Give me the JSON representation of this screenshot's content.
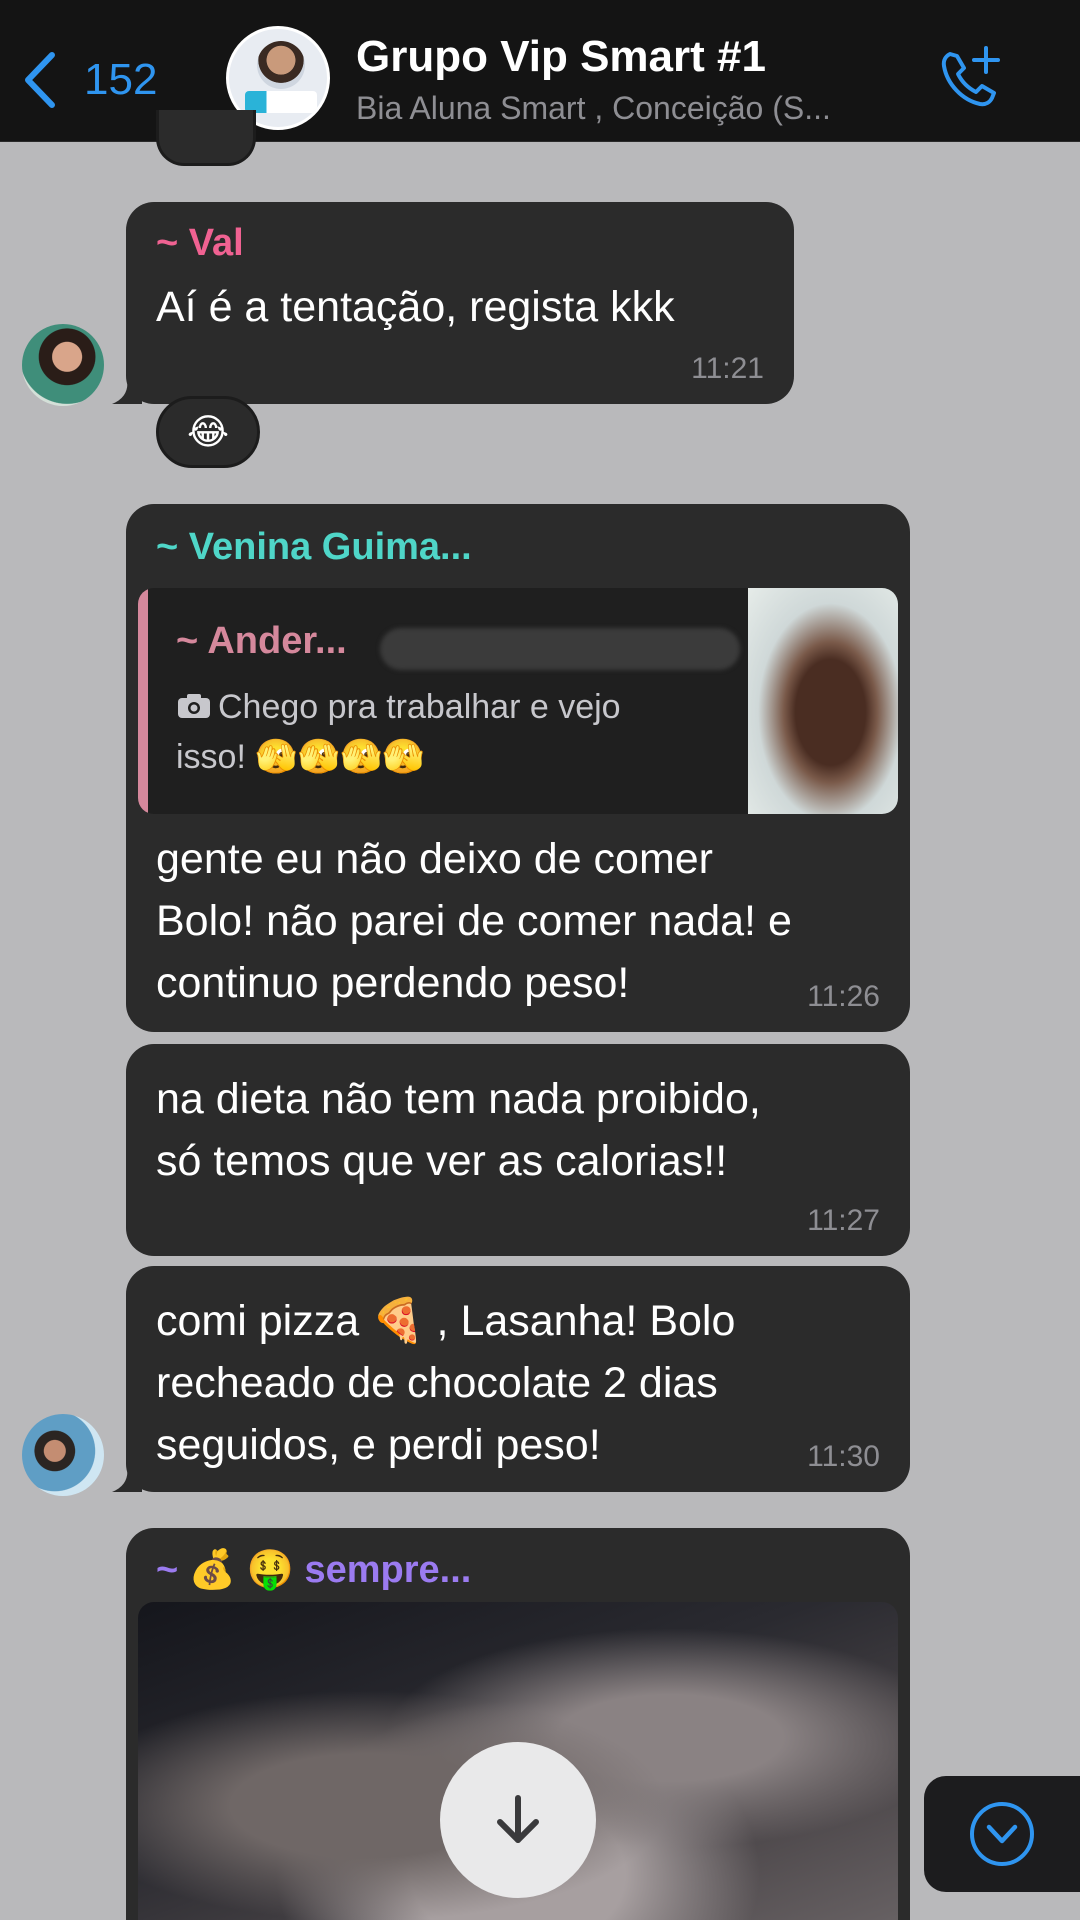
{
  "header": {
    "back_count": "152",
    "title": "Grupo Vip Smart #1",
    "subtitle": "Bia Aluna Smart , Conceição (S..."
  },
  "messages": [
    {
      "sender": "~ Val",
      "sender_color": "#f06292",
      "text": "Aí é a tentação, regista kkk",
      "time": "11:21",
      "reaction": "😂"
    },
    {
      "sender": "~ Venina  Guima...",
      "sender_color": "#4fd6c8",
      "quote_sender": "~ Ander...",
      "quote_text": "Chego pra trabalhar e vejo isso! 🫣🫣🫣🫣",
      "text_lines": [
        "gente eu não deixo de comer",
        "Bolo! não parei de comer nada! e",
        "continuo perdendo peso!"
      ],
      "time": "11:26"
    },
    {
      "text_lines": [
        "na dieta não tem nada proibido,",
        "só temos que ver as calorias!!"
      ],
      "time": "11:27"
    },
    {
      "text_lines": [
        "comi pizza 🍕 , Lasanha! Bolo",
        "recheado de chocolate 2 dias",
        "seguidos, e perdi peso!"
      ],
      "time": "11:30"
    },
    {
      "sender": "~ 💰 🤑 sempre...",
      "sender_color": "#9b7bf0"
    }
  ],
  "colors": {
    "accent": "#2f95f0",
    "background": "#b9b9bb",
    "bubble": "#2b2b2b"
  },
  "icons": [
    "chevron-left-icon",
    "add-call-icon",
    "camera-icon",
    "arrow-down-icon",
    "chevron-down-circle-icon"
  ]
}
